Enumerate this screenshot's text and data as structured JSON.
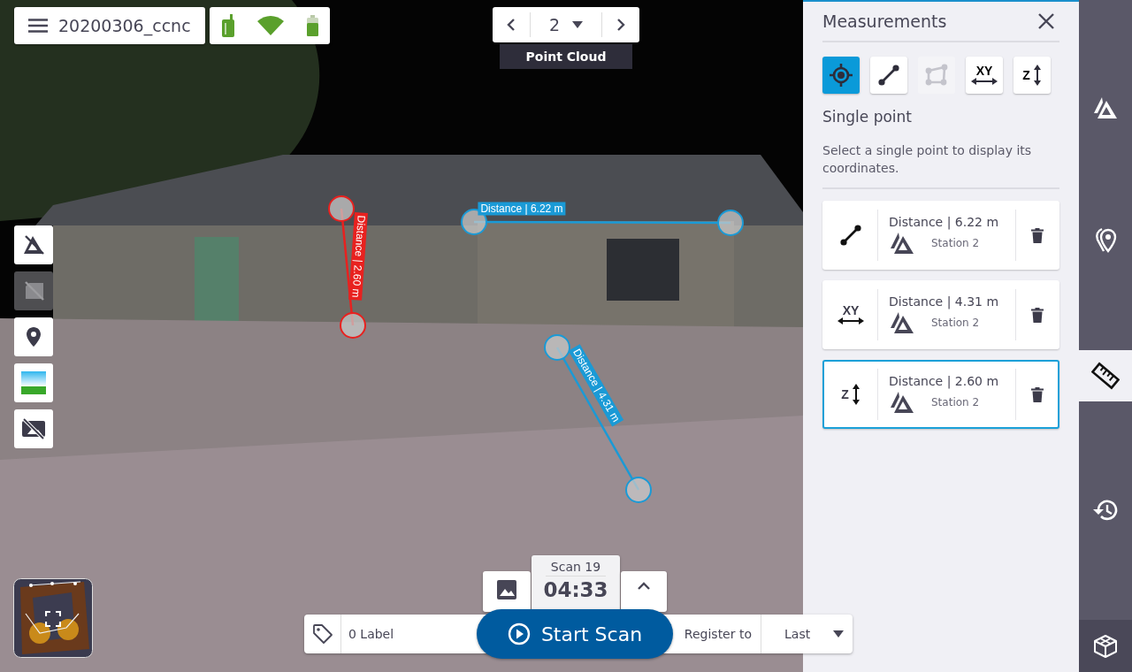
{
  "header": {
    "title": "20200306_ccnc"
  },
  "scan_nav": {
    "value": "2",
    "label": "Point Cloud"
  },
  "side_tools": [
    {
      "kind": "station-off",
      "disabled": false
    },
    {
      "kind": "photo-off",
      "disabled": true
    },
    {
      "kind": "pin",
      "disabled": false
    },
    {
      "kind": "landscape",
      "disabled": false
    },
    {
      "kind": "image-off",
      "disabled": false
    }
  ],
  "overlays": [
    {
      "label": "Distance | 2.60 m",
      "color": "#e8211f"
    },
    {
      "label": "Distance | 6.22 m",
      "color": "#1a9ad6"
    },
    {
      "label": "Distance | 4.31 m",
      "color": "#1a9ad6"
    }
  ],
  "scan": {
    "name": "Scan 19",
    "time": "04:33"
  },
  "label_field": {
    "value": "0 Label"
  },
  "start_button": "Start Scan",
  "register": {
    "label": "Register to",
    "value": "Last"
  },
  "panel": {
    "title": "Measurements",
    "modes": [
      {
        "kind": "point",
        "selected": true,
        "disabled": false
      },
      {
        "kind": "line",
        "selected": false,
        "disabled": false
      },
      {
        "kind": "polygon",
        "selected": false,
        "disabled": true
      },
      {
        "kind": "xy",
        "glyph": "XY",
        "selected": false,
        "disabled": false
      },
      {
        "kind": "z",
        "glyph": "Z",
        "selected": false,
        "disabled": false
      }
    ],
    "mode_title": "Single point",
    "description": "Select a single point to display its coordinates.",
    "items": [
      {
        "kind": "line",
        "title": "Distance | 6.22 m",
        "station": "Station 2",
        "selected": false
      },
      {
        "kind": "xy",
        "glyph": "XY",
        "title": "Distance | 4.31 m",
        "station": "Station 2",
        "selected": false
      },
      {
        "kind": "z",
        "glyph": "Z",
        "title": "Distance | 2.60 m",
        "station": "Station 2",
        "selected": true
      }
    ]
  },
  "rail": [
    {
      "kind": "station",
      "selected": false
    },
    {
      "kind": "pins",
      "selected": false
    },
    {
      "kind": "ruler",
      "selected": true
    },
    {
      "kind": "history",
      "selected": false
    },
    {
      "kind": "box",
      "selected": false
    }
  ]
}
